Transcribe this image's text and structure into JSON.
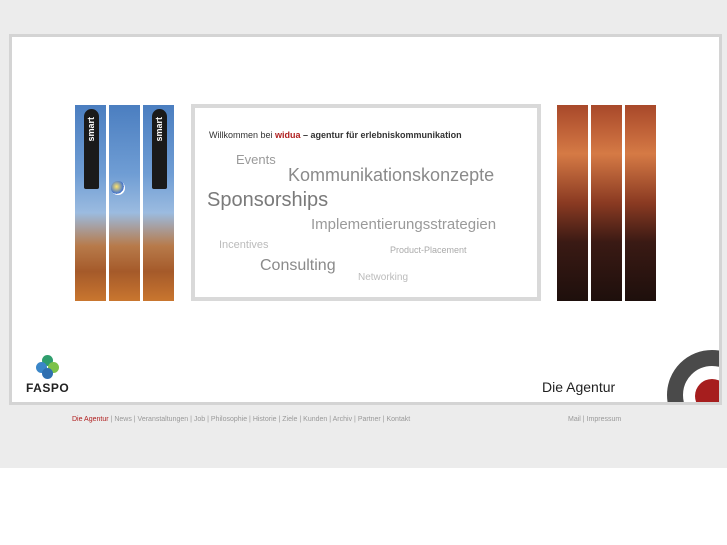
{
  "welcome": {
    "prefix": "Willkommen bei ",
    "brand": "widua",
    "suffix": " – agentur für erlebniskommunikation"
  },
  "words": {
    "events": "Events",
    "kommunikation": "Kommunikationskonzepte",
    "sponsorships": "Sponsorships",
    "implementierung": "Implementierungsstrategien",
    "incentives": "Incentives",
    "product_placement": "Product-Placement",
    "consulting": "Consulting",
    "networking": "Networking"
  },
  "photo_text": {
    "smart": "smart"
  },
  "logo": {
    "text": "FASPO"
  },
  "section_title": "Die Agentur",
  "nav": {
    "items": [
      "Die Agentur",
      "News",
      "Veranstaltungen",
      "Job",
      "Philosophie",
      "Historie",
      "Ziele",
      "Kunden",
      "Archiv",
      "Partner",
      "Kontakt"
    ],
    "separator": " | "
  },
  "util": {
    "items": [
      "Mail",
      "Impressum"
    ],
    "separator": " | "
  },
  "colors": {
    "accent": "#b01e1e",
    "frame_border": "#d4d4d4",
    "page_bg": "#ececec"
  }
}
